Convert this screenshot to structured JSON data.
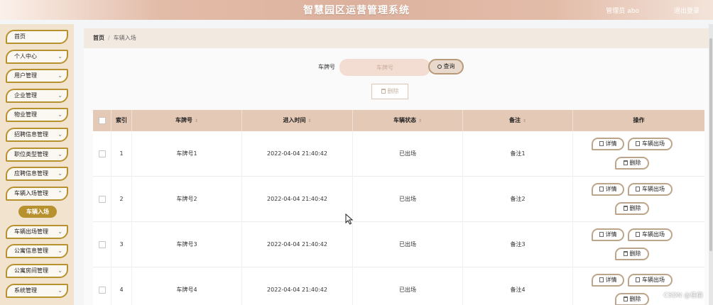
{
  "header": {
    "title": "智慧园区运营管理系统",
    "user_role": "管理员",
    "user_name": "abo",
    "logout": "退出登录"
  },
  "sidebar": {
    "items": [
      {
        "label": "首页"
      },
      {
        "label": "个人中心"
      },
      {
        "label": "用户管理"
      },
      {
        "label": "企业管理"
      },
      {
        "label": "物业管理"
      },
      {
        "label": "招聘信息管理"
      },
      {
        "label": "职位类型管理"
      },
      {
        "label": "应聘信息管理"
      },
      {
        "label": "车辆入场管理"
      },
      {
        "label": "车辆出场管理"
      },
      {
        "label": "公寓信息管理"
      },
      {
        "label": "公寓房间管理"
      },
      {
        "label": "系统管理"
      }
    ],
    "active_sub": "车辆入场",
    "chevron": "chevron-down-icon"
  },
  "breadcrumb": {
    "home": "首页",
    "separator": "/",
    "current": "车辆入场"
  },
  "search": {
    "label": "车牌号",
    "placeholder": "车牌号",
    "button": "查询"
  },
  "toolbar": {
    "delete": "删除"
  },
  "table": {
    "columns": [
      "索引",
      "车牌号",
      "进入时间",
      "车辆状态",
      "备注",
      "操作"
    ],
    "rows": [
      {
        "index": "1",
        "plate": "车牌号1",
        "time": "2022-04-04 21:40:42",
        "status": "已出场",
        "note": "备注1"
      },
      {
        "index": "2",
        "plate": "车牌号2",
        "time": "2022-04-04 21:40:42",
        "status": "已出场",
        "note": "备注2"
      },
      {
        "index": "3",
        "plate": "车牌号3",
        "time": "2022-04-04 21:40:42",
        "status": "已出场",
        "note": "备注3"
      },
      {
        "index": "4",
        "plate": "车牌号4",
        "time": "2022-04-04 21:40:42",
        "status": "已出场",
        "note": "备注4"
      }
    ],
    "actions": {
      "detail": "详情",
      "exit": "车辆出场",
      "delete": "删除"
    }
  },
  "watermark": "CSDN @佳偷",
  "colors": {
    "accent": "#b8912f",
    "header_bg": "#dcb29e",
    "table_head": "#e4c9b6",
    "sidebar_bg": "#f1e3ce"
  }
}
